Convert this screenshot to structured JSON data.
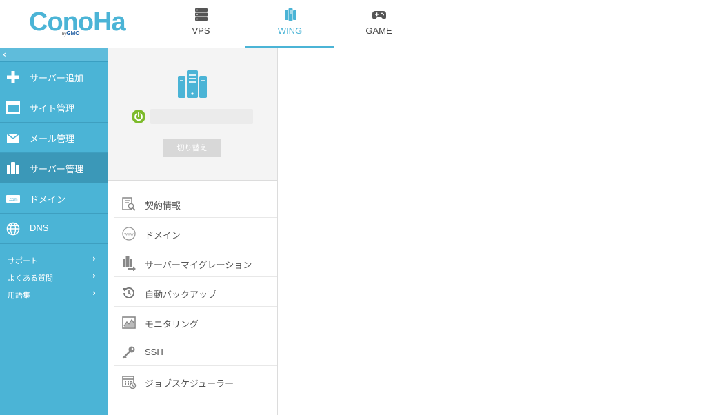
{
  "brand": {
    "logo_text": "ConoHa",
    "logo_sub_by": "by",
    "logo_sub_gmo": "GMO",
    "accent_color": "#4bb4d6"
  },
  "topnav": {
    "tabs": [
      {
        "label": "VPS",
        "icon": "server-rack-icon",
        "active": false
      },
      {
        "label": "WING",
        "icon": "wing-servers-icon",
        "active": true
      },
      {
        "label": "GAME",
        "icon": "gamepad-icon",
        "active": false
      }
    ]
  },
  "sidebar": {
    "collapse_glyph": "‹",
    "items": [
      {
        "label": "サーバー追加",
        "icon": "plus-icon",
        "active": false
      },
      {
        "label": "サイト管理",
        "icon": "window-icon",
        "active": false
      },
      {
        "label": "メール管理",
        "icon": "envelope-icon",
        "active": false
      },
      {
        "label": "サーバー管理",
        "icon": "server-icon",
        "active": true
      },
      {
        "label": "ドメイン",
        "icon": "dotcom-icon",
        "active": false
      },
      {
        "label": "DNS",
        "icon": "globe-icon",
        "active": false
      }
    ],
    "sub_items": [
      {
        "label": "サポート",
        "chevron": "›"
      },
      {
        "label": "よくある質問",
        "chevron": "›"
      },
      {
        "label": "用語集",
        "chevron": "›"
      }
    ]
  },
  "server_card": {
    "status_color": "#7dbb2c",
    "switch_label": "切り替え"
  },
  "server_menu": {
    "items": [
      {
        "label": "契約情報",
        "icon": "contract-search-icon"
      },
      {
        "label": "ドメイン",
        "icon": "www-icon"
      },
      {
        "label": "サーバーマイグレーション",
        "icon": "migration-icon"
      },
      {
        "label": "自動バックアップ",
        "icon": "backup-history-icon"
      },
      {
        "label": "モニタリング",
        "icon": "monitoring-chart-icon"
      },
      {
        "label": "SSH",
        "icon": "key-icon"
      },
      {
        "label": "ジョブスケジューラー",
        "icon": "scheduler-calendar-icon"
      }
    ]
  }
}
